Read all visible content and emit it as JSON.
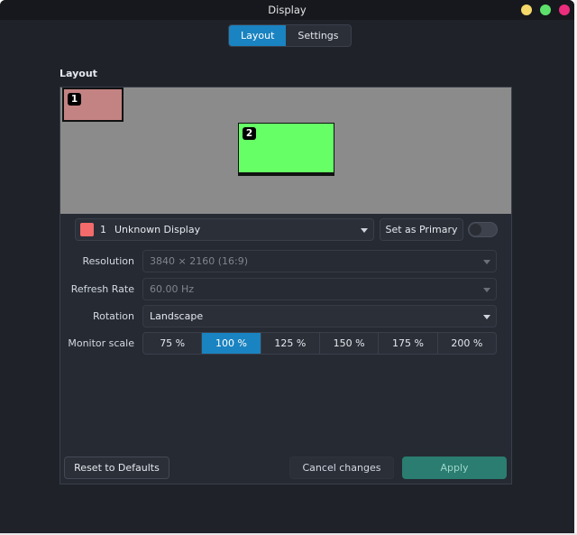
{
  "window": {
    "title": "Display"
  },
  "tabs": [
    {
      "label": "Layout",
      "active": true
    },
    {
      "label": "Settings",
      "active": false
    }
  ],
  "layout": {
    "section_title": "Layout",
    "monitors": [
      {
        "number": "1",
        "color": "#c48383"
      },
      {
        "number": "2",
        "color": "#66ff66"
      }
    ]
  },
  "display_select": {
    "number": "1",
    "name": "Unknown Display",
    "swatch_color": "#f36b6b"
  },
  "primary": {
    "label": "Set as Primary",
    "enabled": false
  },
  "settings": {
    "resolution": {
      "label": "Resolution",
      "value": "3840 × 2160 (16:9)"
    },
    "refresh_rate": {
      "label": "Refresh Rate",
      "value": "60.00 Hz"
    },
    "rotation": {
      "label": "Rotation",
      "value": "Landscape"
    },
    "monitor_scale": {
      "label": "Monitor scale",
      "options": [
        "75 %",
        "100 %",
        "125 %",
        "150 %",
        "175 %",
        "200 %"
      ],
      "selected": "100 %"
    }
  },
  "buttons": {
    "reset": "Reset to Defaults",
    "cancel": "Cancel changes",
    "apply": "Apply"
  },
  "colors": {
    "accent": "#1a83c1",
    "apply": "#2a7d70",
    "window_bg": "#1f2229"
  }
}
